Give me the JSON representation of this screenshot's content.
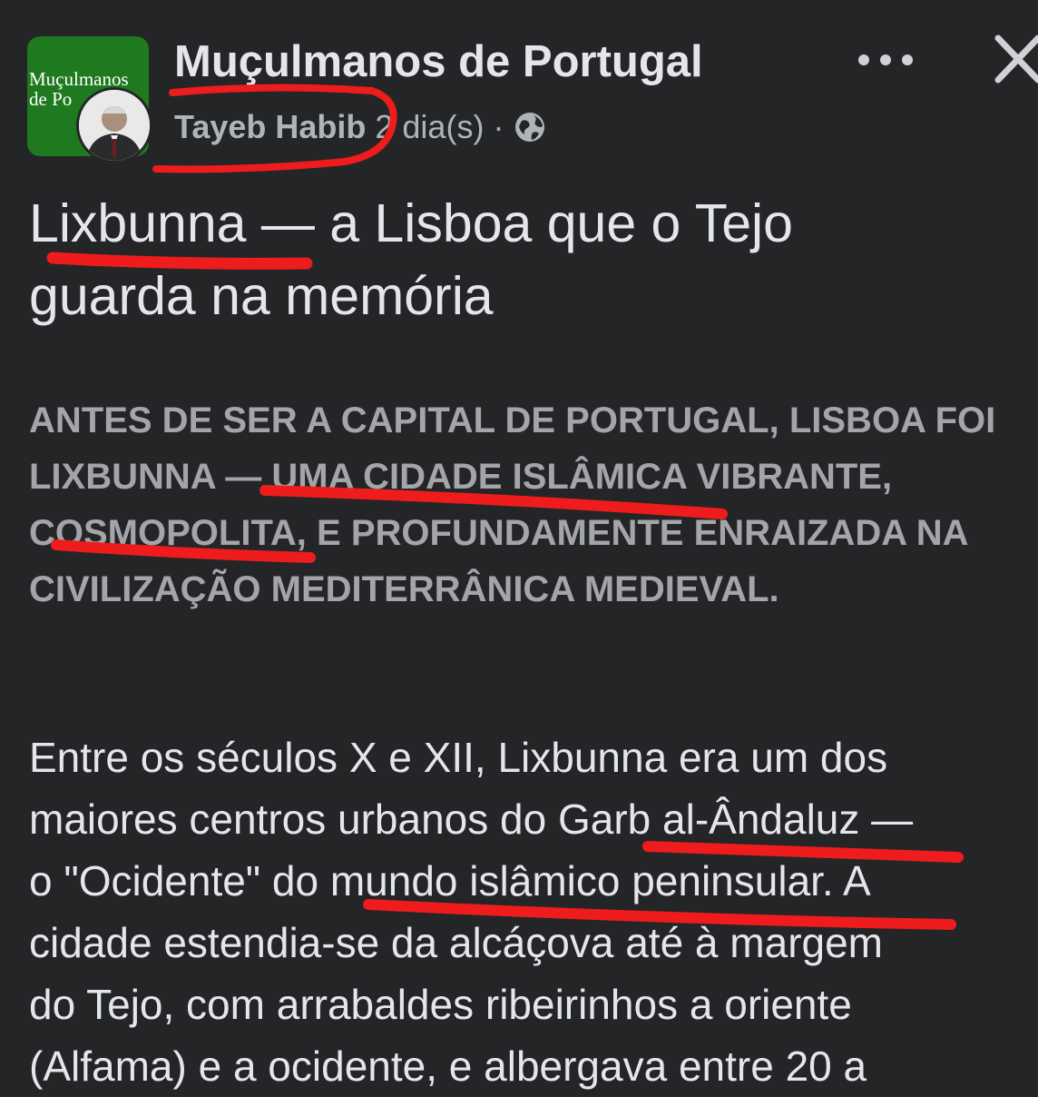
{
  "header": {
    "group_avatar_text": "Muçulmanos\nde Po",
    "group_name": "Muçulmanos de Portugal",
    "author_name": "Tayeb Habib",
    "post_time": "2 dia(s)",
    "separator": "·",
    "privacy_icon": "globe-icon",
    "more_icon": "more-options-icon",
    "close_icon": "close-icon"
  },
  "post": {
    "title_lines": [
      "Lixbunna — a Lisboa que o Tejo",
      "guarda na memória"
    ],
    "subtitle_lines": [
      "ANTES DE SER A CAPITAL DE PORTUGAL, LISBOA FOI",
      "LIXBUNNA — UMA CIDADE ISLÂMICA VIBRANTE,",
      "COSMOPOLITA, E PROFUNDAMENTE ENRAIZADA NA",
      "CIVILIZAÇÃO MEDITERRÂNICA MEDIEVAL."
    ],
    "body_lines": [
      "Entre os séculos X e XII, Lixbunna era um dos",
      "maiores centros urbanos do Garb al-Ândaluz —",
      "o \"Ocidente\" do mundo islâmico peninsular. A",
      "cidade estendia-se da alcáçova até à margem",
      "do Tejo, com arrabaldes ribeirinhos a oriente",
      "(Alfama) e a ocidente, e albergava entre 20 a"
    ]
  },
  "colors": {
    "background": "#242526",
    "primary_text": "#e4e6eb",
    "secondary_text": "#b0b3b8",
    "group_avatar_bg": "#1f7a1f",
    "annotation_red": "#ee1c1c"
  }
}
